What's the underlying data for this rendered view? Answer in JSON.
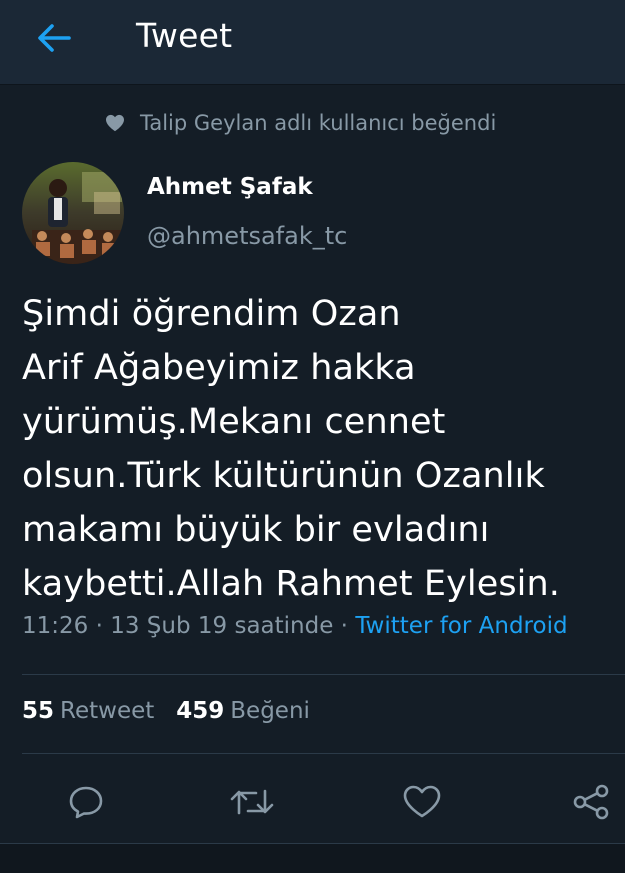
{
  "header": {
    "title": "Tweet",
    "back_icon": "arrow-left-icon"
  },
  "social_context": {
    "icon": "heart-icon",
    "text": "Talip Geylan adlı kullanıcı beğendi"
  },
  "author": {
    "name": "Ahmet Şafak",
    "handle": "@ahmetsafak_tc"
  },
  "tweet": {
    "text": "Şimdi öğrendim Ozan\nArif Ağabeyimiz hakka\nyürümüş.Mekanı cennet\nolsun.Türk kültürünün Ozanlık\nmakamı büyük bir evladını\nkaybetti.Allah Rahmet Eylesin.",
    "time": "11:26 · 13 Şub 19 saatinde · ",
    "source": "Twitter for Android"
  },
  "stats": {
    "retweets": {
      "count": "55",
      "label": "Retweet"
    },
    "likes": {
      "count": "459",
      "label": "Beğeni"
    }
  },
  "actions": [
    {
      "name": "reply",
      "icon": "reply-icon"
    },
    {
      "name": "retweet",
      "icon": "retweet-icon"
    },
    {
      "name": "like",
      "icon": "heart-icon"
    },
    {
      "name": "share",
      "icon": "share-icon"
    }
  ],
  "colors": {
    "background": "#141d26",
    "header": "#1b2836",
    "accent": "#1da1f2",
    "muted": "#8899a6",
    "text": "#ffffff"
  }
}
